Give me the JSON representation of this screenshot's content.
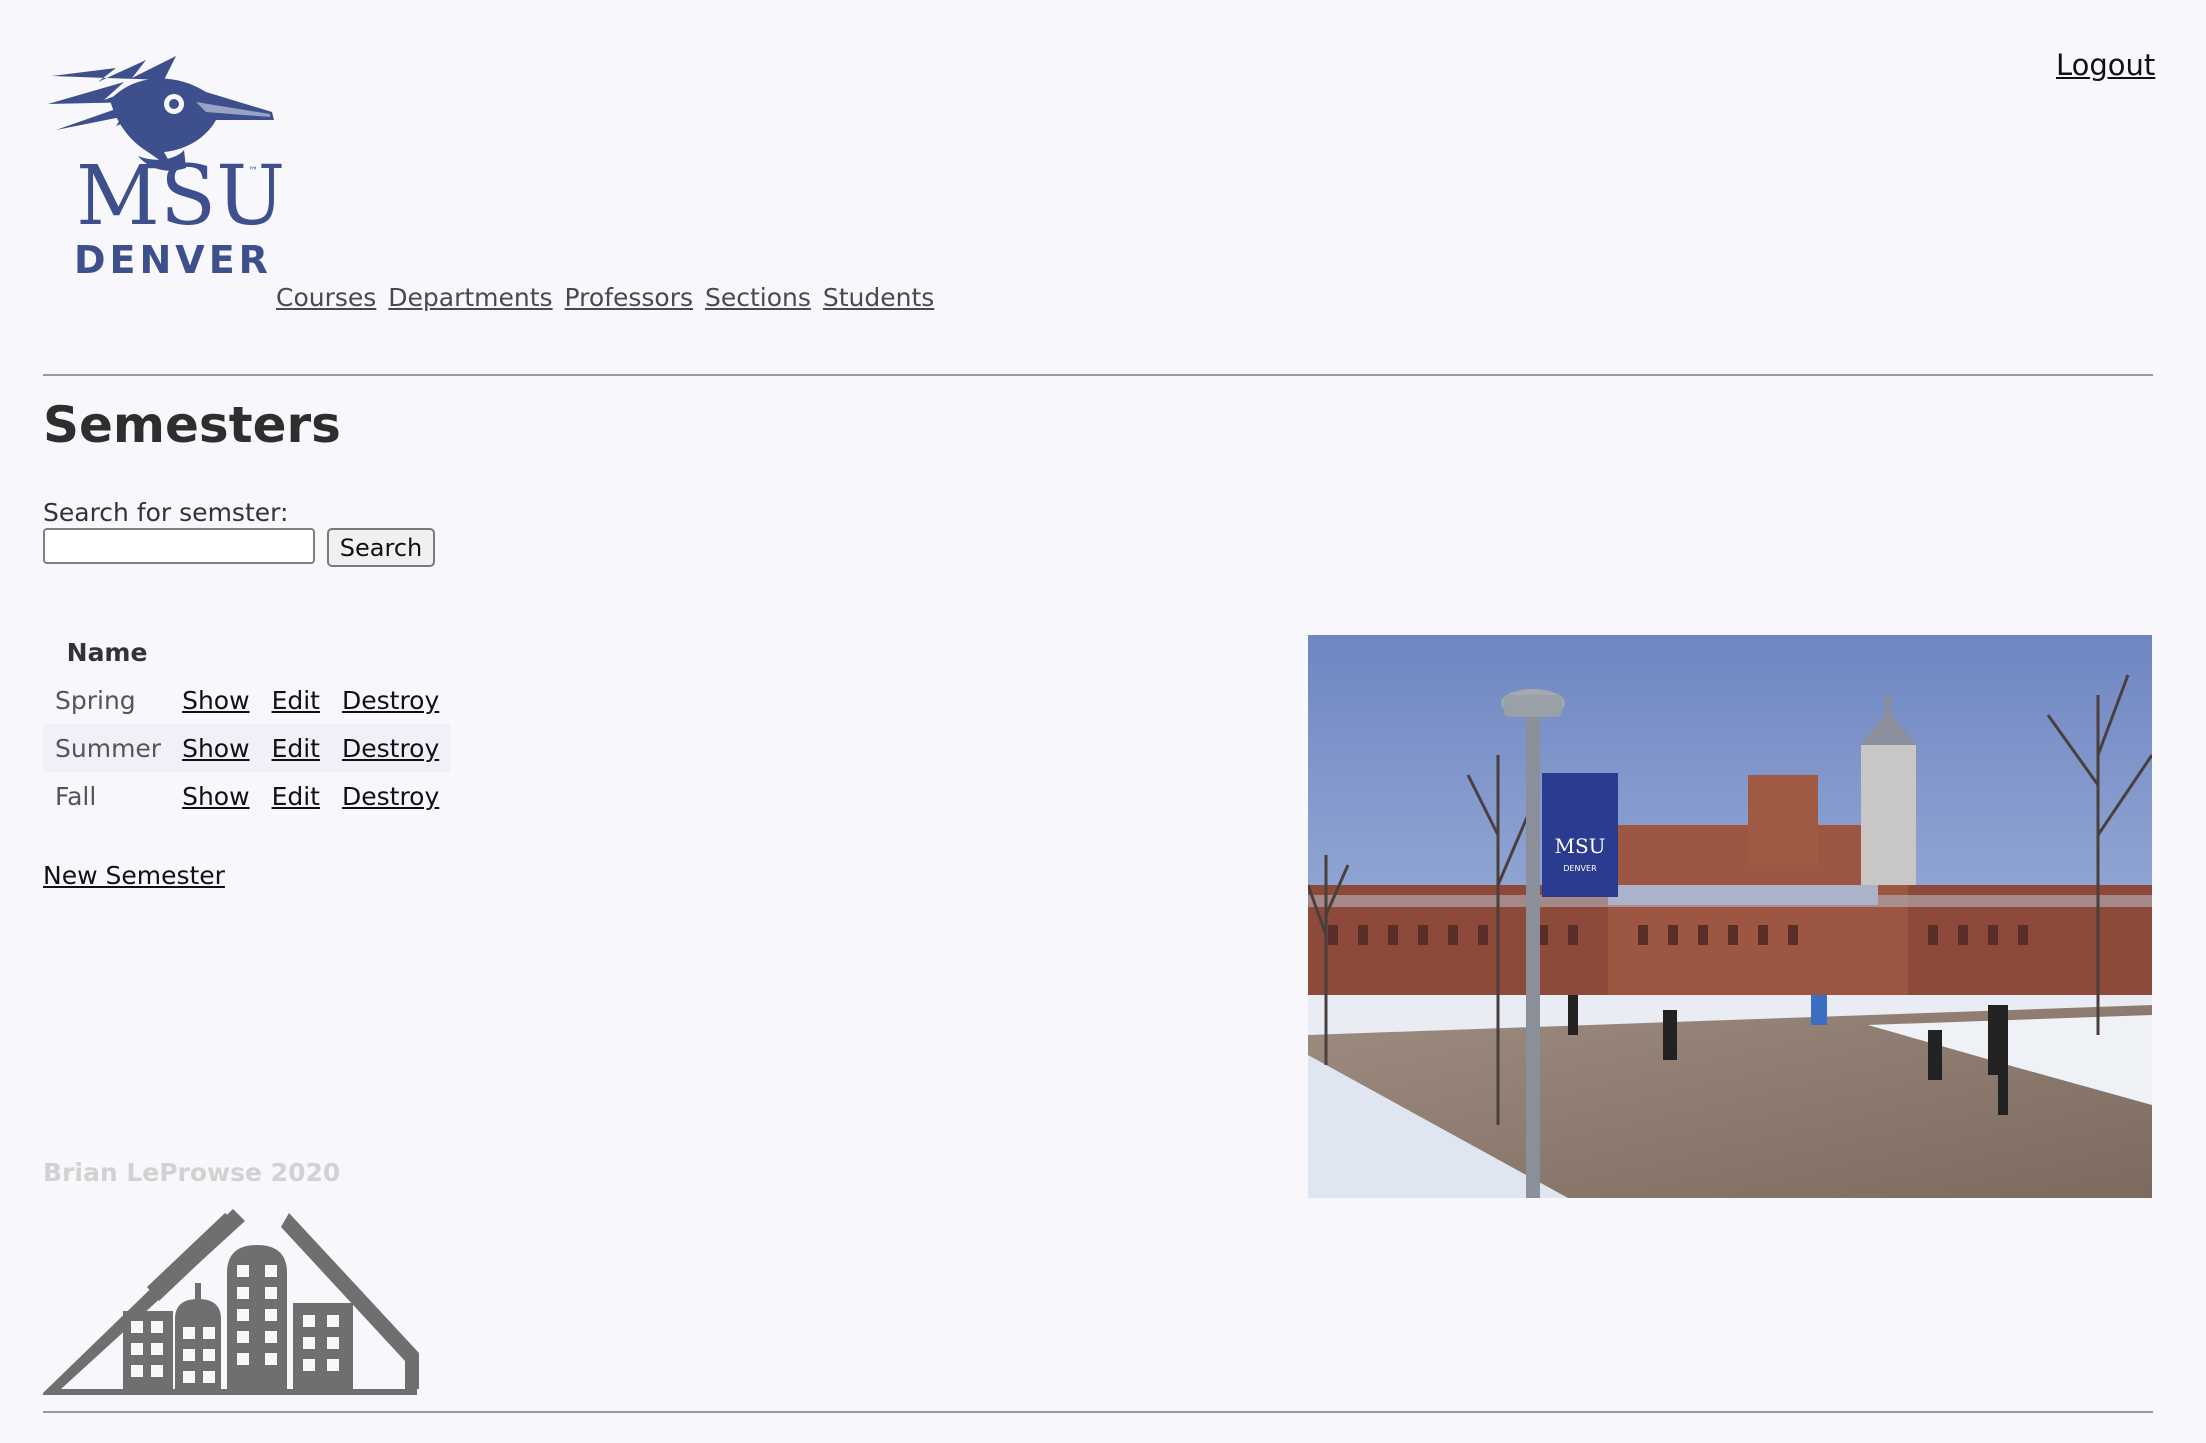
{
  "header": {
    "logo": {
      "icon": "roadrunner-icon",
      "line1": "MSU",
      "trademark": "™",
      "line2": "DENVER",
      "color": "#3d4f8c"
    },
    "logout_label": "Logout",
    "nav": [
      {
        "label": "Courses"
      },
      {
        "label": "Departments"
      },
      {
        "label": "Professors"
      },
      {
        "label": "Sections"
      },
      {
        "label": "Students"
      }
    ]
  },
  "main": {
    "title": "Semesters",
    "search": {
      "label": "Search for semster:",
      "value": "",
      "placeholder": "",
      "button_label": "Search"
    },
    "table": {
      "header": "Name",
      "rows": [
        {
          "name": "Spring",
          "show": "Show",
          "edit": "Edit",
          "destroy": "Destroy"
        },
        {
          "name": "Summer",
          "show": "Show",
          "edit": "Edit",
          "destroy": "Destroy"
        },
        {
          "name": "Fall",
          "show": "Show",
          "edit": "Edit",
          "destroy": "Destroy"
        }
      ]
    },
    "new_link": "New Semester",
    "photo": {
      "subject": "campus-photo",
      "banner_line1": "MSU",
      "banner_line2": "DENVER"
    }
  },
  "footer": {
    "credit": "Brian LeProwse 2020",
    "logo_icon": "buildings-icon"
  }
}
